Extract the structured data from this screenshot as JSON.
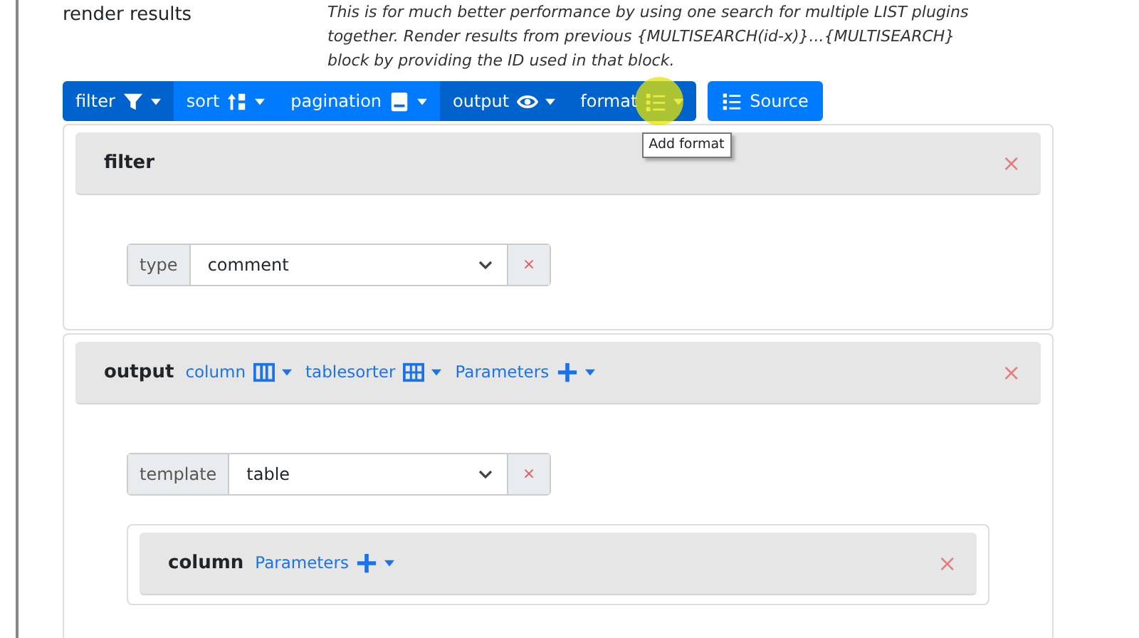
{
  "setting": {
    "label": "render results",
    "description": [
      "This is for much better performance by using one search for multiple LIST plugins",
      "together. Render results from previous {MULTISEARCH(id-x)}...{MULTISEARCH}",
      "block by providing the ID used in that block."
    ]
  },
  "toolbar": {
    "buttons": [
      {
        "label": "filter",
        "selected": true
      },
      {
        "label": "sort",
        "selected": false
      },
      {
        "label": "pagination",
        "selected": false
      },
      {
        "label": "output",
        "selected": true
      },
      {
        "label": "format",
        "selected": true,
        "hovered": true
      }
    ],
    "tooltip": "Add format",
    "source_button": "Source"
  },
  "blocks": [
    {
      "title": "filter",
      "close": "×",
      "fields": [
        {
          "label": "type",
          "value": "comment",
          "remove": "×"
        }
      ]
    },
    {
      "title": "output",
      "close": "×",
      "links": [
        {
          "label": "column"
        },
        {
          "label": "tablesorter"
        },
        {
          "label": "Parameters"
        }
      ],
      "fields": [
        {
          "label": "template",
          "value": "table",
          "remove": "×"
        }
      ],
      "children": [
        {
          "title": "column",
          "close": "×",
          "links": [
            {
              "label": "Parameters"
            }
          ]
        }
      ]
    }
  ]
}
